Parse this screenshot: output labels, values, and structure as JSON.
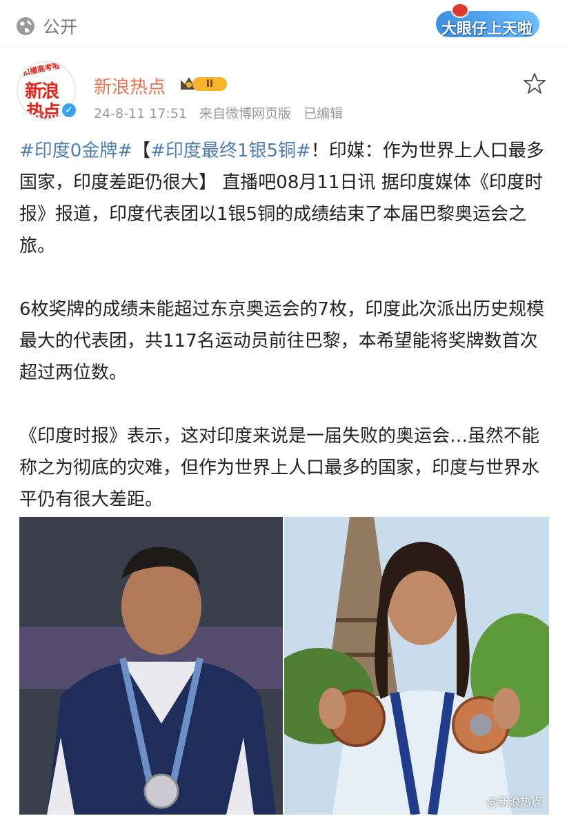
{
  "topbar": {
    "visibility_label": "公开",
    "visibility_icon": "globe-icon",
    "logo_text": "大眼仔上天啦"
  },
  "author": {
    "avatar_banner": "扣播高考啦",
    "avatar_line1": "新浪",
    "avatar_line2": "热点",
    "name": "新浪热点",
    "badge_level": "II",
    "timestamp": "24-8-11 17:51",
    "source": "来自微博网页版",
    "edited": "已编辑"
  },
  "post": {
    "tag1": "#印度0金牌#",
    "bracket_open": "【",
    "tag2": "#印度最终1银5铜#",
    "headline": "！印媒：作为世界上人口最多国家，印度差距仍很大】",
    "intro": " 直播吧08月11日讯 据印度媒体《印度时报》报道，印度代表团以1银5铜的成绩结束了本届巴黎奥运会之旅。",
    "para2": "6枚奖牌的成绩未能超过东京奥运会的7枚，印度此次派出历史规模最大的代表团，共117名运动员前往巴黎，本希望能将奖牌数首次超过两位数。",
    "para3": "《印度时报》表示，这对印度来说是一届失败的奥运会…虽然不能称之为彻底的灾难，但作为世界上人口最多的国家，印度与世界水平仍有很大差距。"
  },
  "images": {
    "watermark": "@新浪热点"
  },
  "colors": {
    "tag": "#507daf",
    "author_name": "#eb7350",
    "meta": "#999999"
  }
}
